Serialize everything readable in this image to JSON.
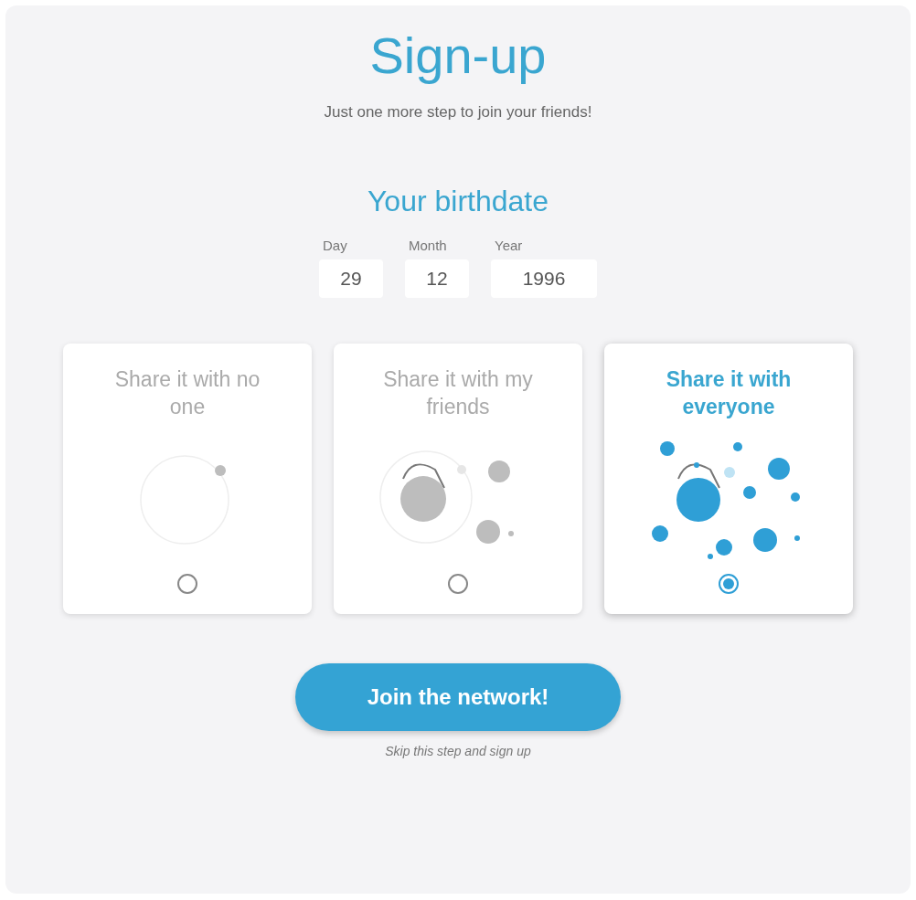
{
  "title": "Sign-up",
  "subtitle": "Just one more step to join your friends!",
  "birthdate": {
    "heading": "Your birthdate",
    "fields": [
      {
        "label": "Day",
        "value": "29"
      },
      {
        "label": "Month",
        "value": "12"
      },
      {
        "label": "Year",
        "value": "1996"
      }
    ]
  },
  "sharing_options": [
    {
      "kind": "none",
      "title": "Share it with no one",
      "selected": false
    },
    {
      "kind": "friends",
      "title": "Share it with my friends",
      "selected": false
    },
    {
      "kind": "everyone",
      "title": "Share it with everyone",
      "selected": true
    }
  ],
  "primary_button": "Join the network!",
  "skip_link": "Skip this step and sign up"
}
